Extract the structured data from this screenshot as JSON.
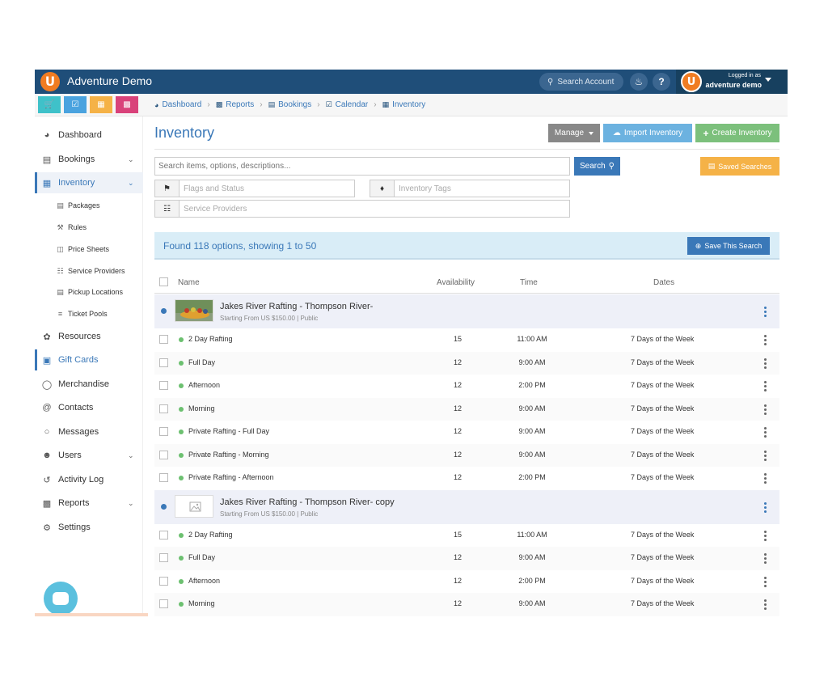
{
  "header": {
    "app_title": "Adventure Demo",
    "search_account": "Search Account",
    "help": "?",
    "logged_in_label": "Logged in as",
    "user_name": "adventure demo"
  },
  "quick_buttons": [
    {
      "icon": "cart-icon",
      "color": "#3fc1c9"
    },
    {
      "icon": "calendar-check-icon",
      "color": "#4aa3df"
    },
    {
      "icon": "briefcase-icon",
      "color": "#f5b247"
    },
    {
      "icon": "bar-chart-icon",
      "color": "#d9427a"
    }
  ],
  "breadcrumb": [
    "Dashboard",
    "Reports",
    "Bookings",
    "Calendar",
    "Inventory"
  ],
  "sidebar": {
    "items": [
      {
        "label": "Dashboard",
        "icon": "dashboard-icon"
      },
      {
        "label": "Bookings",
        "icon": "bookings-icon"
      },
      {
        "label": "Inventory",
        "icon": "briefcase-icon"
      },
      {
        "label": "Resources",
        "icon": "leaf-icon"
      },
      {
        "label": "Gift Cards",
        "icon": "gift-icon"
      },
      {
        "label": "Merchandise",
        "icon": "tag-icon"
      },
      {
        "label": "Contacts",
        "icon": "at-icon"
      },
      {
        "label": "Messages",
        "icon": "chat-icon"
      },
      {
        "label": "Users",
        "icon": "users-icon"
      },
      {
        "label": "Activity Log",
        "icon": "history-icon"
      },
      {
        "label": "Reports",
        "icon": "bar-chart-icon"
      },
      {
        "label": "Settings",
        "icon": "gears-icon"
      }
    ],
    "sub_items": [
      {
        "label": "Packages",
        "icon": "calendar-icon"
      },
      {
        "label": "Rules",
        "icon": "gavel-icon"
      },
      {
        "label": "Price Sheets",
        "icon": "map-icon"
      },
      {
        "label": "Service Providers",
        "icon": "sitemap-icon"
      },
      {
        "label": "Pickup Locations",
        "icon": "bus-icon"
      },
      {
        "label": "Ticket Pools",
        "icon": "layers-icon"
      }
    ]
  },
  "main": {
    "title": "Inventory",
    "manage_label": "Manage",
    "import_label": "Import Inventory",
    "create_label": "Create Inventory",
    "search_placeholder": "Search items, options, descriptions...",
    "search_button": "Search",
    "saved_searches": "Saved Searches",
    "filters": {
      "flags_placeholder": "Flags and Status",
      "tags_placeholder": "Inventory Tags",
      "providers_placeholder": "Service Providers"
    },
    "found_text": "Found 118 options, showing 1 to 50",
    "save_search": "Save This Search",
    "columns": {
      "name": "Name",
      "availability": "Availability",
      "time": "Time",
      "dates": "Dates"
    },
    "groups": [
      {
        "name": "Jakes River Rafting - Thompson River-",
        "sub": "Starting From US $150.00 | Public",
        "thumb": "photo",
        "options": [
          {
            "name": "2 Day Rafting",
            "availability": "15",
            "time": "11:00 AM",
            "dates": "7 Days of the Week"
          },
          {
            "name": "Full Day",
            "availability": "12",
            "time": "9:00 AM",
            "dates": "7 Days of the Week"
          },
          {
            "name": "Afternoon",
            "availability": "12",
            "time": "2:00 PM",
            "dates": "7 Days of the Week"
          },
          {
            "name": "Morning",
            "availability": "12",
            "time": "9:00 AM",
            "dates": "7 Days of the Week"
          },
          {
            "name": "Private Rafting - Full Day",
            "availability": "12",
            "time": "9:00 AM",
            "dates": "7 Days of the Week"
          },
          {
            "name": "Private Rafting - Morning",
            "availability": "12",
            "time": "9:00 AM",
            "dates": "7 Days of the Week"
          },
          {
            "name": "Private Rafting - Afternoon",
            "availability": "12",
            "time": "2:00 PM",
            "dates": "7 Days of the Week"
          }
        ]
      },
      {
        "name": "Jakes River Rafting - Thompson River- copy",
        "sub": "Starting From US $150.00 | Public",
        "thumb": "placeholder",
        "options": [
          {
            "name": "2 Day Rafting",
            "availability": "15",
            "time": "11:00 AM",
            "dates": "7 Days of the Week"
          },
          {
            "name": "Full Day",
            "availability": "12",
            "time": "9:00 AM",
            "dates": "7 Days of the Week"
          },
          {
            "name": "Afternoon",
            "availability": "12",
            "time": "2:00 PM",
            "dates": "7 Days of the Week"
          },
          {
            "name": "Morning",
            "availability": "12",
            "time": "9:00 AM",
            "dates": "7 Days of the Week"
          }
        ]
      }
    ]
  },
  "colors": {
    "header_bg": "#1f4e79",
    "accent": "#3a78b8",
    "import": "#6cb2e0",
    "create": "#7cc07c",
    "saved": "#f5b247",
    "status_green": "#6cc070"
  }
}
